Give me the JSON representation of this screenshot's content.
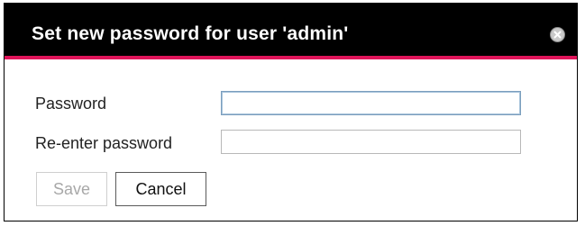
{
  "dialog": {
    "title": "Set new password for user 'admin'",
    "close_icon": "close-circle-icon",
    "accent_color": "#e0145a",
    "title_bar_color": "#000000"
  },
  "form": {
    "password_label": "Password",
    "password_value": "",
    "reenter_label": "Re-enter password",
    "reenter_value": ""
  },
  "buttons": {
    "save_label": "Save",
    "save_disabled": true,
    "cancel_label": "Cancel"
  }
}
